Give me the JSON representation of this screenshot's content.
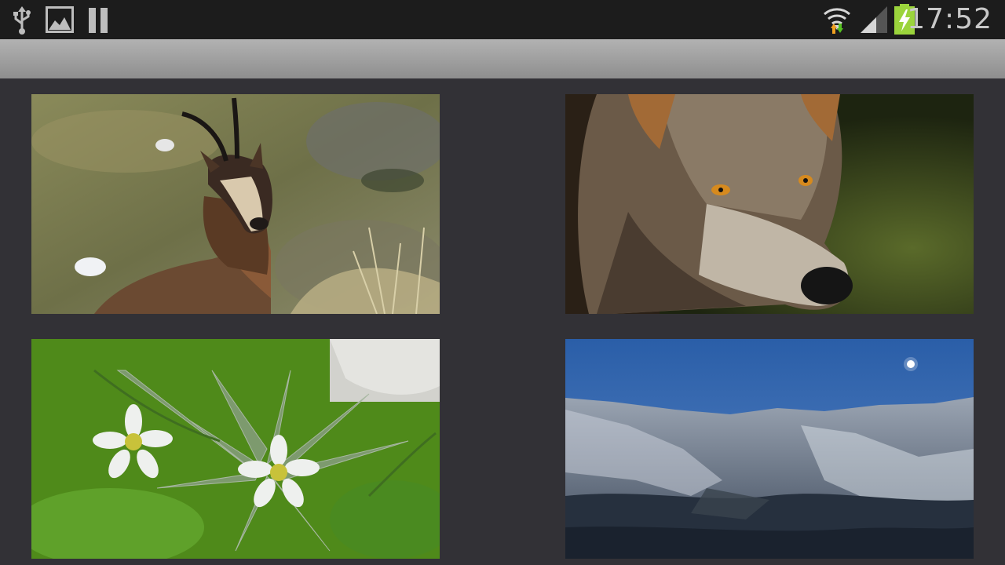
{
  "status_bar": {
    "time": "17:52",
    "left_icons": [
      "usb-icon",
      "image-icon",
      "pause-icon"
    ],
    "right_icons": [
      "wifi-icon",
      "signal-icon",
      "battery-charging-icon"
    ]
  },
  "action_bar": {
    "title": ""
  },
  "gallery": {
    "items": [
      {
        "subject": "chamois"
      },
      {
        "subject": "wolf"
      },
      {
        "subject": "edelweiss"
      },
      {
        "subject": "mountains-night"
      }
    ]
  }
}
